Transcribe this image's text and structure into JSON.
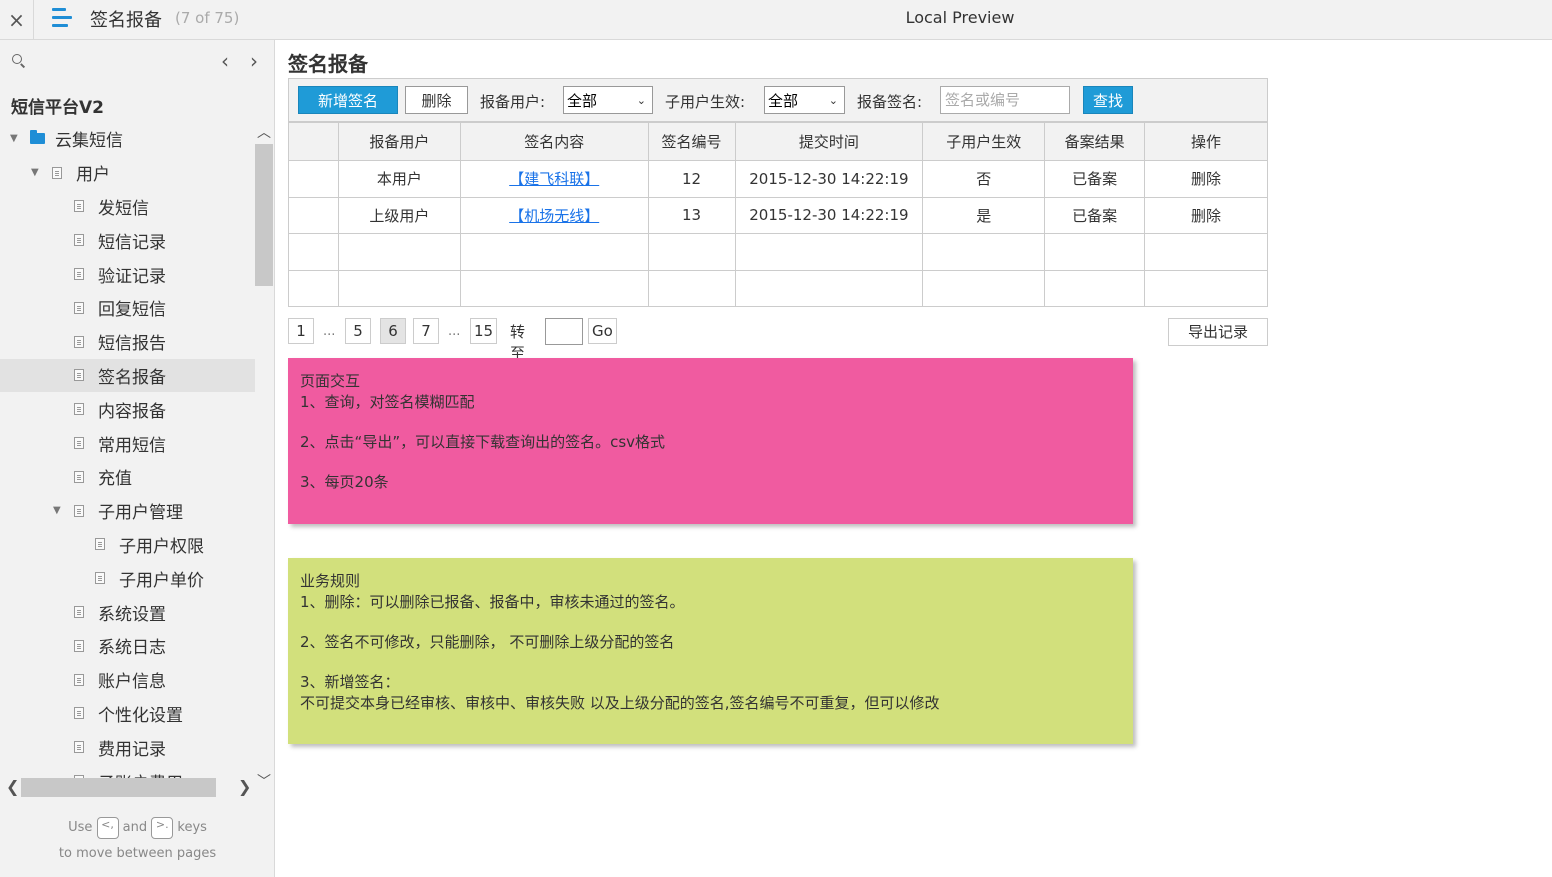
{
  "topbar": {
    "close_label": "×",
    "page_title": "签名报备",
    "page_count": "(7 of 75)",
    "center_title": "Local Preview"
  },
  "sidebar": {
    "prev_arrow": "‹",
    "next_arrow": "›",
    "project_name": "短信平台V2",
    "tree": [
      {
        "label": "云集短信",
        "level": 0,
        "type": "folder",
        "expanded": true
      },
      {
        "label": "用户",
        "level": 1,
        "type": "page",
        "expanded": true
      },
      {
        "label": "发短信",
        "level": 2,
        "type": "page"
      },
      {
        "label": "短信记录",
        "level": 2,
        "type": "page"
      },
      {
        "label": "验证记录",
        "level": 2,
        "type": "page"
      },
      {
        "label": "回复短信",
        "level": 2,
        "type": "page"
      },
      {
        "label": "短信报告",
        "level": 2,
        "type": "page"
      },
      {
        "label": "签名报备",
        "level": 2,
        "type": "page",
        "active": true
      },
      {
        "label": "内容报备",
        "level": 2,
        "type": "page"
      },
      {
        "label": "常用短信",
        "level": 2,
        "type": "page"
      },
      {
        "label": "充值",
        "level": 2,
        "type": "page"
      },
      {
        "label": "子用户管理",
        "level": 2,
        "type": "page",
        "expanded": true
      },
      {
        "label": "子用户权限",
        "level": 3,
        "type": "page"
      },
      {
        "label": "子用户单价",
        "level": 3,
        "type": "page"
      },
      {
        "label": "系统设置",
        "level": 2,
        "type": "page"
      },
      {
        "label": "系统日志",
        "level": 2,
        "type": "page"
      },
      {
        "label": "账户信息",
        "level": 2,
        "type": "page"
      },
      {
        "label": "个性化设置",
        "level": 2,
        "type": "page"
      },
      {
        "label": "费用记录",
        "level": 2,
        "type": "page"
      },
      {
        "label": "子账户费用",
        "level": 2,
        "type": "page"
      }
    ],
    "hint": {
      "use": "Use",
      "and": "and",
      "keys": "keys",
      "line2": "to move between pages",
      "key_prev": "<,",
      "key_next": ">."
    }
  },
  "main": {
    "heading": "签名报备",
    "toolbar": {
      "add_label": "新增签名",
      "delete_label": "删除",
      "user_label": "报备用户:",
      "user_value": "全部",
      "sub_label": "子用户生效:",
      "sub_value": "全部",
      "sign_label": "报备签名:",
      "sign_placeholder": "签名或编号",
      "search_label": "查找"
    },
    "table": {
      "headers": [
        "",
        "报备用户",
        "签名内容",
        "签名编号",
        "提交时间",
        "子用户生效",
        "备案结果",
        "操作"
      ],
      "rows": [
        [
          "",
          "本用户",
          "【建飞科联】",
          "12",
          "2015-12-30 14:22:19",
          "否",
          "已备案",
          "删除"
        ],
        [
          "",
          "上级用户",
          "【机场无线】",
          "13",
          "2015-12-30 14:22:19",
          "是",
          "已备案",
          "删除"
        ]
      ]
    },
    "pager": {
      "pages": [
        "1",
        "5",
        "6",
        "7",
        "15"
      ],
      "current": "6",
      "ellipsis": "...",
      "goto_label": "转至",
      "go_label": "Go",
      "export_label": "导出记录"
    },
    "note_interaction": {
      "color": "#f05ba0",
      "title": "页面交互",
      "line1": "1、查询，对签名模糊匹配",
      "line2": "2、点击“导出”，可以直接下载查询出的签名。csv格式",
      "line3": "3、每页20条"
    },
    "note_rules": {
      "color": "#d2e07c",
      "title": "业务规则",
      "line1": "1、删除：可以删除已报备、报备中，审核未通过的签名。",
      "line2": "2、签名不可修改，只能删除， 不可删除上级分配的签名",
      "line3": "3、新增签名：",
      "line4": "不可提交本身已经审核、审核中、审核失败 以及上级分配的签名,签名编号不可重复，但可以修改"
    }
  }
}
